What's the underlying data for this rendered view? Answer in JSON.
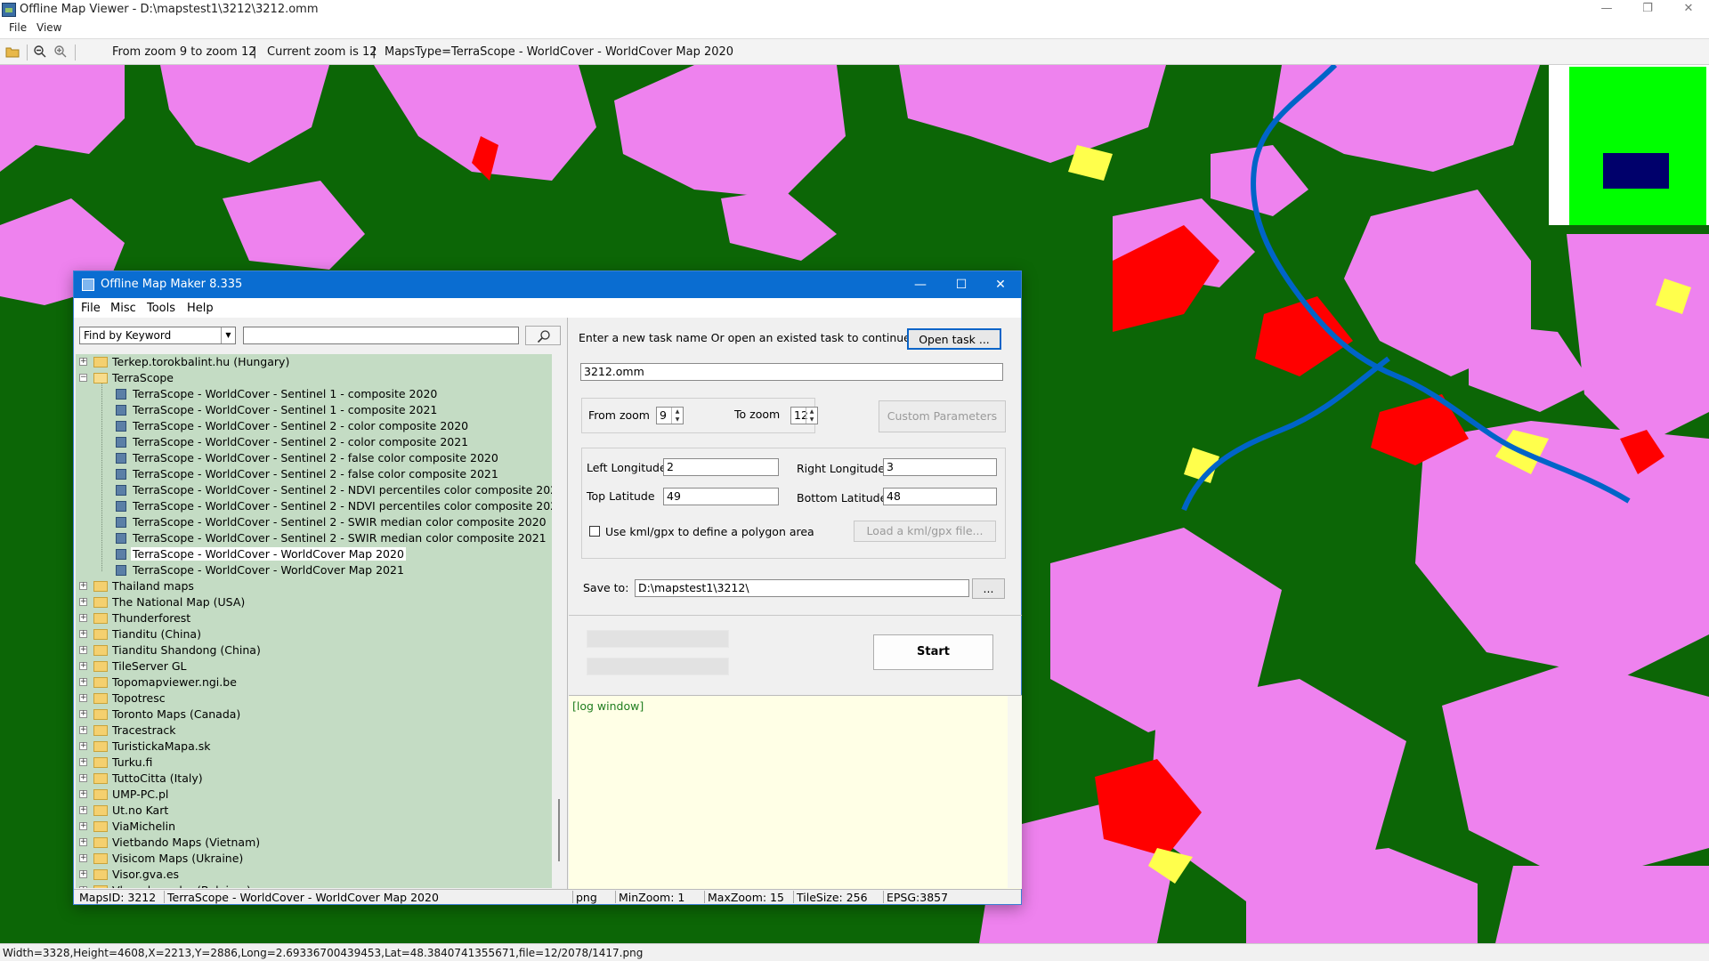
{
  "window": {
    "title": "Offline Map Viewer - D:\\mapstest1\\3212\\3212.omm",
    "minimize": "—",
    "maximize": "❐",
    "close": "✕"
  },
  "menubar": {
    "items": [
      "File",
      "View"
    ]
  },
  "toolbar": {
    "zoom_range": "From zoom 9 to zoom 12",
    "current_zoom": "Current zoom is 12",
    "maps_type": "MapsType=TerraScope - WorldCover - WorldCover Map 2020",
    "sep1": "|",
    "sep2": "|"
  },
  "map": {
    "colors": {
      "forest": "#0c6606",
      "cropland": "#ee82ee",
      "urban": "#ff0000",
      "grass": "#ffff4c",
      "water": "#0064c8"
    }
  },
  "statusbar": {
    "text": "Width=3328,Height=4608,X=2213,Y=2886,Long=2.69336700439453,Lat=48.3840741355671,file=12/2078/1417.png"
  },
  "dialog": {
    "title": "Offline Map Maker 8.335",
    "minimize": "—",
    "maximize": "☐",
    "close": "✕",
    "menu": [
      "File",
      "Misc",
      "Tools",
      "Help"
    ],
    "keyword_select": "Find by Keyword",
    "search_value": "",
    "tree": [
      {
        "label": "Terkep.torokbalint.hu (Hungary)",
        "level": 0,
        "expand": "+",
        "icon": "folder"
      },
      {
        "label": "TerraScope",
        "level": 0,
        "expand": "−",
        "icon": "folder-open"
      },
      {
        "label": "TerraScope - WorldCover - Sentinel 1 - composite 2020",
        "level": 1,
        "icon": "map"
      },
      {
        "label": "TerraScope - WorldCover - Sentinel 1 - composite 2021",
        "level": 1,
        "icon": "map"
      },
      {
        "label": "TerraScope - WorldCover - Sentinel 2 - color composite 2020",
        "level": 1,
        "icon": "map"
      },
      {
        "label": "TerraScope - WorldCover - Sentinel 2 - color composite 2021",
        "level": 1,
        "icon": "map"
      },
      {
        "label": "TerraScope - WorldCover - Sentinel 2 - false color composite 2020",
        "level": 1,
        "icon": "map"
      },
      {
        "label": "TerraScope - WorldCover - Sentinel 2 - false color composite 2021",
        "level": 1,
        "icon": "map"
      },
      {
        "label": "TerraScope - WorldCover - Sentinel 2 - NDVI percentiles color composite 2020",
        "level": 1,
        "icon": "map"
      },
      {
        "label": "TerraScope - WorldCover - Sentinel 2 - NDVI percentiles color composite 2021",
        "level": 1,
        "icon": "map"
      },
      {
        "label": "TerraScope - WorldCover - Sentinel 2 - SWIR median color composite 2020",
        "level": 1,
        "icon": "map"
      },
      {
        "label": "TerraScope - WorldCover - Sentinel 2 - SWIR median color composite 2021",
        "level": 1,
        "icon": "map"
      },
      {
        "label": "TerraScope - WorldCover - WorldCover Map 2020",
        "level": 1,
        "icon": "map",
        "selected": true
      },
      {
        "label": "TerraScope - WorldCover - WorldCover Map 2021",
        "level": 1,
        "icon": "map"
      },
      {
        "label": "Thailand maps",
        "level": 0,
        "expand": "+",
        "icon": "folder"
      },
      {
        "label": "The National Map (USA)",
        "level": 0,
        "expand": "+",
        "icon": "folder"
      },
      {
        "label": "Thunderforest",
        "level": 0,
        "expand": "+",
        "icon": "folder"
      },
      {
        "label": "Tianditu (China)",
        "level": 0,
        "expand": "+",
        "icon": "folder"
      },
      {
        "label": "Tianditu Shandong (China)",
        "level": 0,
        "expand": "+",
        "icon": "folder"
      },
      {
        "label": "TileServer GL",
        "level": 0,
        "expand": "+",
        "icon": "folder"
      },
      {
        "label": "Topomapviewer.ngi.be",
        "level": 0,
        "expand": "+",
        "icon": "folder"
      },
      {
        "label": "Topotresc",
        "level": 0,
        "expand": "+",
        "icon": "folder"
      },
      {
        "label": "Toronto Maps (Canada)",
        "level": 0,
        "expand": "+",
        "icon": "folder"
      },
      {
        "label": "Tracestrack",
        "level": 0,
        "expand": "+",
        "icon": "folder"
      },
      {
        "label": "TuristickaMapa.sk",
        "level": 0,
        "expand": "+",
        "icon": "folder"
      },
      {
        "label": "Turku.fi",
        "level": 0,
        "expand": "+",
        "icon": "folder"
      },
      {
        "label": "TuttoCitta (Italy)",
        "level": 0,
        "expand": "+",
        "icon": "folder"
      },
      {
        "label": "UMP-PC.pl",
        "level": 0,
        "expand": "+",
        "icon": "folder"
      },
      {
        "label": "Ut.no Kart",
        "level": 0,
        "expand": "+",
        "icon": "folder"
      },
      {
        "label": "ViaMichelin",
        "level": 0,
        "expand": "+",
        "icon": "folder"
      },
      {
        "label": "Vietbando Maps (Vietnam)",
        "level": 0,
        "expand": "+",
        "icon": "folder"
      },
      {
        "label": "Visicom Maps (Ukraine)",
        "level": 0,
        "expand": "+",
        "icon": "folder"
      },
      {
        "label": "Visor.gva.es",
        "level": 0,
        "expand": "+",
        "icon": "folder"
      },
      {
        "label": "Vlaanderen.be (Belgium)",
        "level": 0,
        "expand": "+",
        "icon": "folder"
      }
    ],
    "task_prompt": "Enter a new task name Or open an existed task to continue:",
    "open_task": "Open task ...",
    "task_name": "3212.omm",
    "from_zoom_label": "From zoom",
    "from_zoom": "9",
    "to_zoom_label": "To zoom",
    "to_zoom": "12",
    "custom_params": "Custom Parameters",
    "left_lon_label": "Left Longitude",
    "left_lon": "2",
    "right_lon_label": "Right Longitude",
    "right_lon": "3",
    "top_lat_label": "Top Latitude",
    "top_lat": "49",
    "bottom_lat_label": "Bottom Latitude",
    "bottom_lat": "48",
    "kml_checkbox": "Use kml/gpx to define a polygon area",
    "load_kml": "Load a kml/gpx file...",
    "save_to_label": "Save to:",
    "save_to": "D:\\mapstest1\\3212\\",
    "browse": "...",
    "start": "Start",
    "log": "[log window]",
    "status": {
      "maps_id": "MapsID: 3212",
      "name": "TerraScope - WorldCover - WorldCover Map 2020",
      "format": "png",
      "min_zoom": "MinZoom: 1",
      "max_zoom": "MaxZoom: 15",
      "tile_size": "TileSize: 256",
      "epsg": "EPSG:3857"
    }
  }
}
